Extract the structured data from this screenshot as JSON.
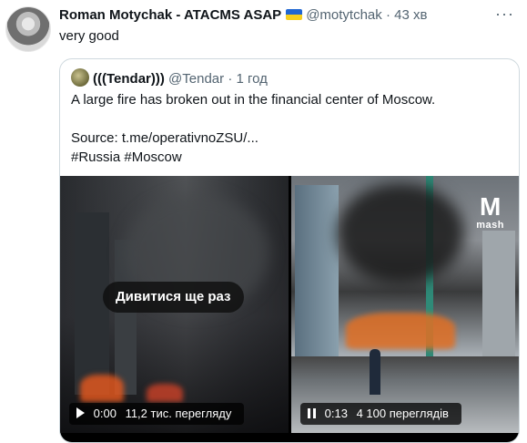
{
  "tweet": {
    "author_name": "Roman Motychak - ATACMS ASAP",
    "flag_icon": "ukraine-flag-icon",
    "handle": "@motytchak",
    "time": "· 43 хв",
    "text": "very good",
    "more_icon": "more-icon"
  },
  "quote": {
    "author_name": "(((Tendar)))",
    "handle": "@Tendar",
    "time": "· 1 год",
    "lines": [
      "A large fire has broken out in the financial center of Moscow.",
      "",
      "Source: t.me/operativnoZSU/...",
      "#Russia #Moscow"
    ]
  },
  "videos": [
    {
      "replay_label": "Дивитися ще раз",
      "time": "0:00",
      "views": "11,2 тис. перегляду",
      "control_icon": "play-icon"
    },
    {
      "watermark": "mash",
      "time": "0:13",
      "views": "4 100 переглядів",
      "control_icon": "pause-icon"
    }
  ]
}
